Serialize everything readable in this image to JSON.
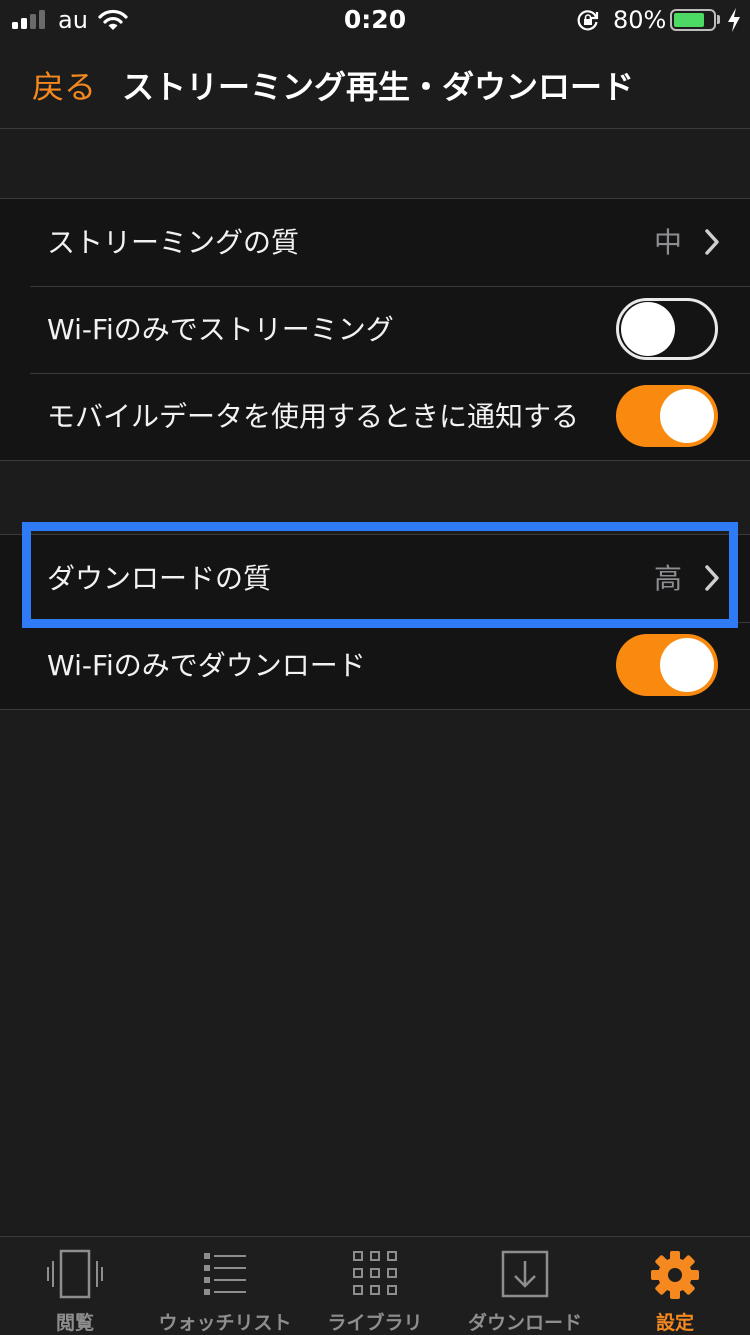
{
  "status_bar": {
    "carrier": "au",
    "time": "0:20",
    "battery_percent": "80%",
    "battery_level": 0.8,
    "signal_bars": 2
  },
  "nav": {
    "back_label": "戻る",
    "title": "ストリーミング再生・ダウンロード"
  },
  "streaming": {
    "quality_label": "ストリーミングの質",
    "quality_value": "中",
    "wifi_only_label": "Wi-Fiのみでストリーミング",
    "wifi_only_on": false,
    "mobile_notify_label": "モバイルデータを使用するときに通知する",
    "mobile_notify_on": true
  },
  "download": {
    "quality_label": "ダウンロードの質",
    "quality_value": "高",
    "wifi_only_label": "Wi-Fiのみでダウンロード",
    "wifi_only_on": true
  },
  "tabs": [
    {
      "label": "閲覧",
      "icon": "phone-vibrate-icon",
      "active": false
    },
    {
      "label": "ウォッチリスト",
      "icon": "list-icon",
      "active": false
    },
    {
      "label": "ライブラリ",
      "icon": "grid-icon",
      "active": false
    },
    {
      "label": "ダウンロード",
      "icon": "download-icon",
      "active": false
    },
    {
      "label": "設定",
      "icon": "gear-icon",
      "active": true
    }
  ],
  "colors": {
    "accent": "#f5891f",
    "toggle_on": "#fa8a0f",
    "highlight": "#2f7bf5",
    "background": "#1c1c1c",
    "cell": "#141414"
  }
}
